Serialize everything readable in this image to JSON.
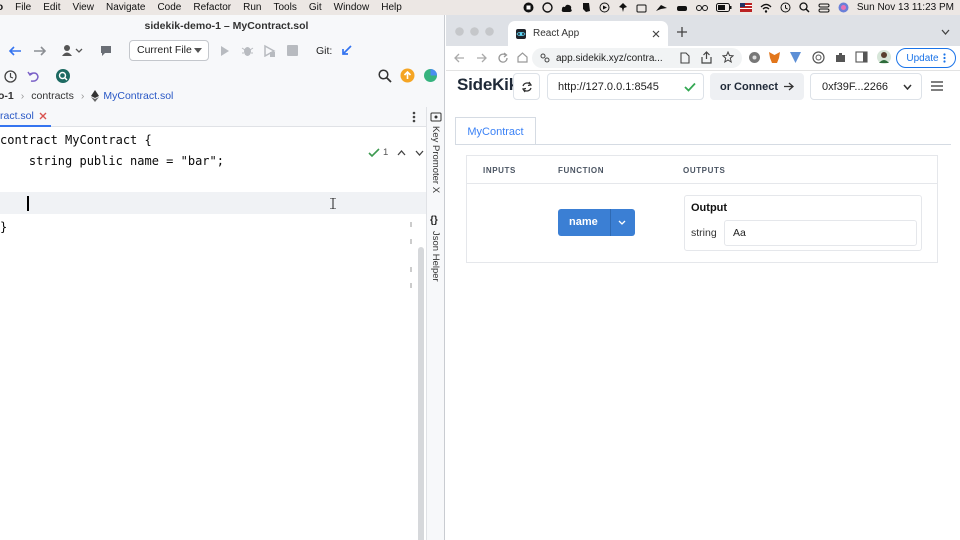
{
  "menubar": {
    "items": [
      "o",
      "File",
      "Edit",
      "View",
      "Navigate",
      "Code",
      "Refactor",
      "Run",
      "Tools",
      "Git",
      "Window",
      "Help"
    ],
    "clock": "Sun Nov 13  11:23 PM"
  },
  "ide": {
    "window_title": "sidekik-demo-1 – MyContract.sol",
    "run_config": "Current File",
    "git_label": "Git:",
    "breadcrumb": {
      "project": "o-1",
      "folder": "contracts",
      "file": "MyContract.sol"
    },
    "tab_label": "ract.sol",
    "inspection_count": "1",
    "code": {
      "line1": "contract MyContract {",
      "line2": "    string public name = \"bar\";",
      "line4": "}"
    },
    "side_tools": {
      "key_promoter": "Key Promoter X",
      "json_helper": "Json Helper"
    }
  },
  "browser": {
    "tab_title": "React App",
    "url": "app.sidekik.xyz/contra...",
    "update_label": "Update"
  },
  "app": {
    "logo": "SideKik",
    "rpc_url": "http://127.0.0.1:8545",
    "connect_label": "or Connect",
    "account": "0xf39F...2266",
    "contract_tab": "MyContract",
    "table": {
      "inputs_header": "INPUTS",
      "function_header": "FUNCTION",
      "outputs_header": "OUTPUTS",
      "function_name": "name",
      "output_title": "Output",
      "output_type": "string",
      "output_value": "Aa"
    }
  },
  "colors": {
    "accent_blue": "#3b7fd4",
    "ide_link": "#2857c5",
    "check_green": "#34a853"
  }
}
